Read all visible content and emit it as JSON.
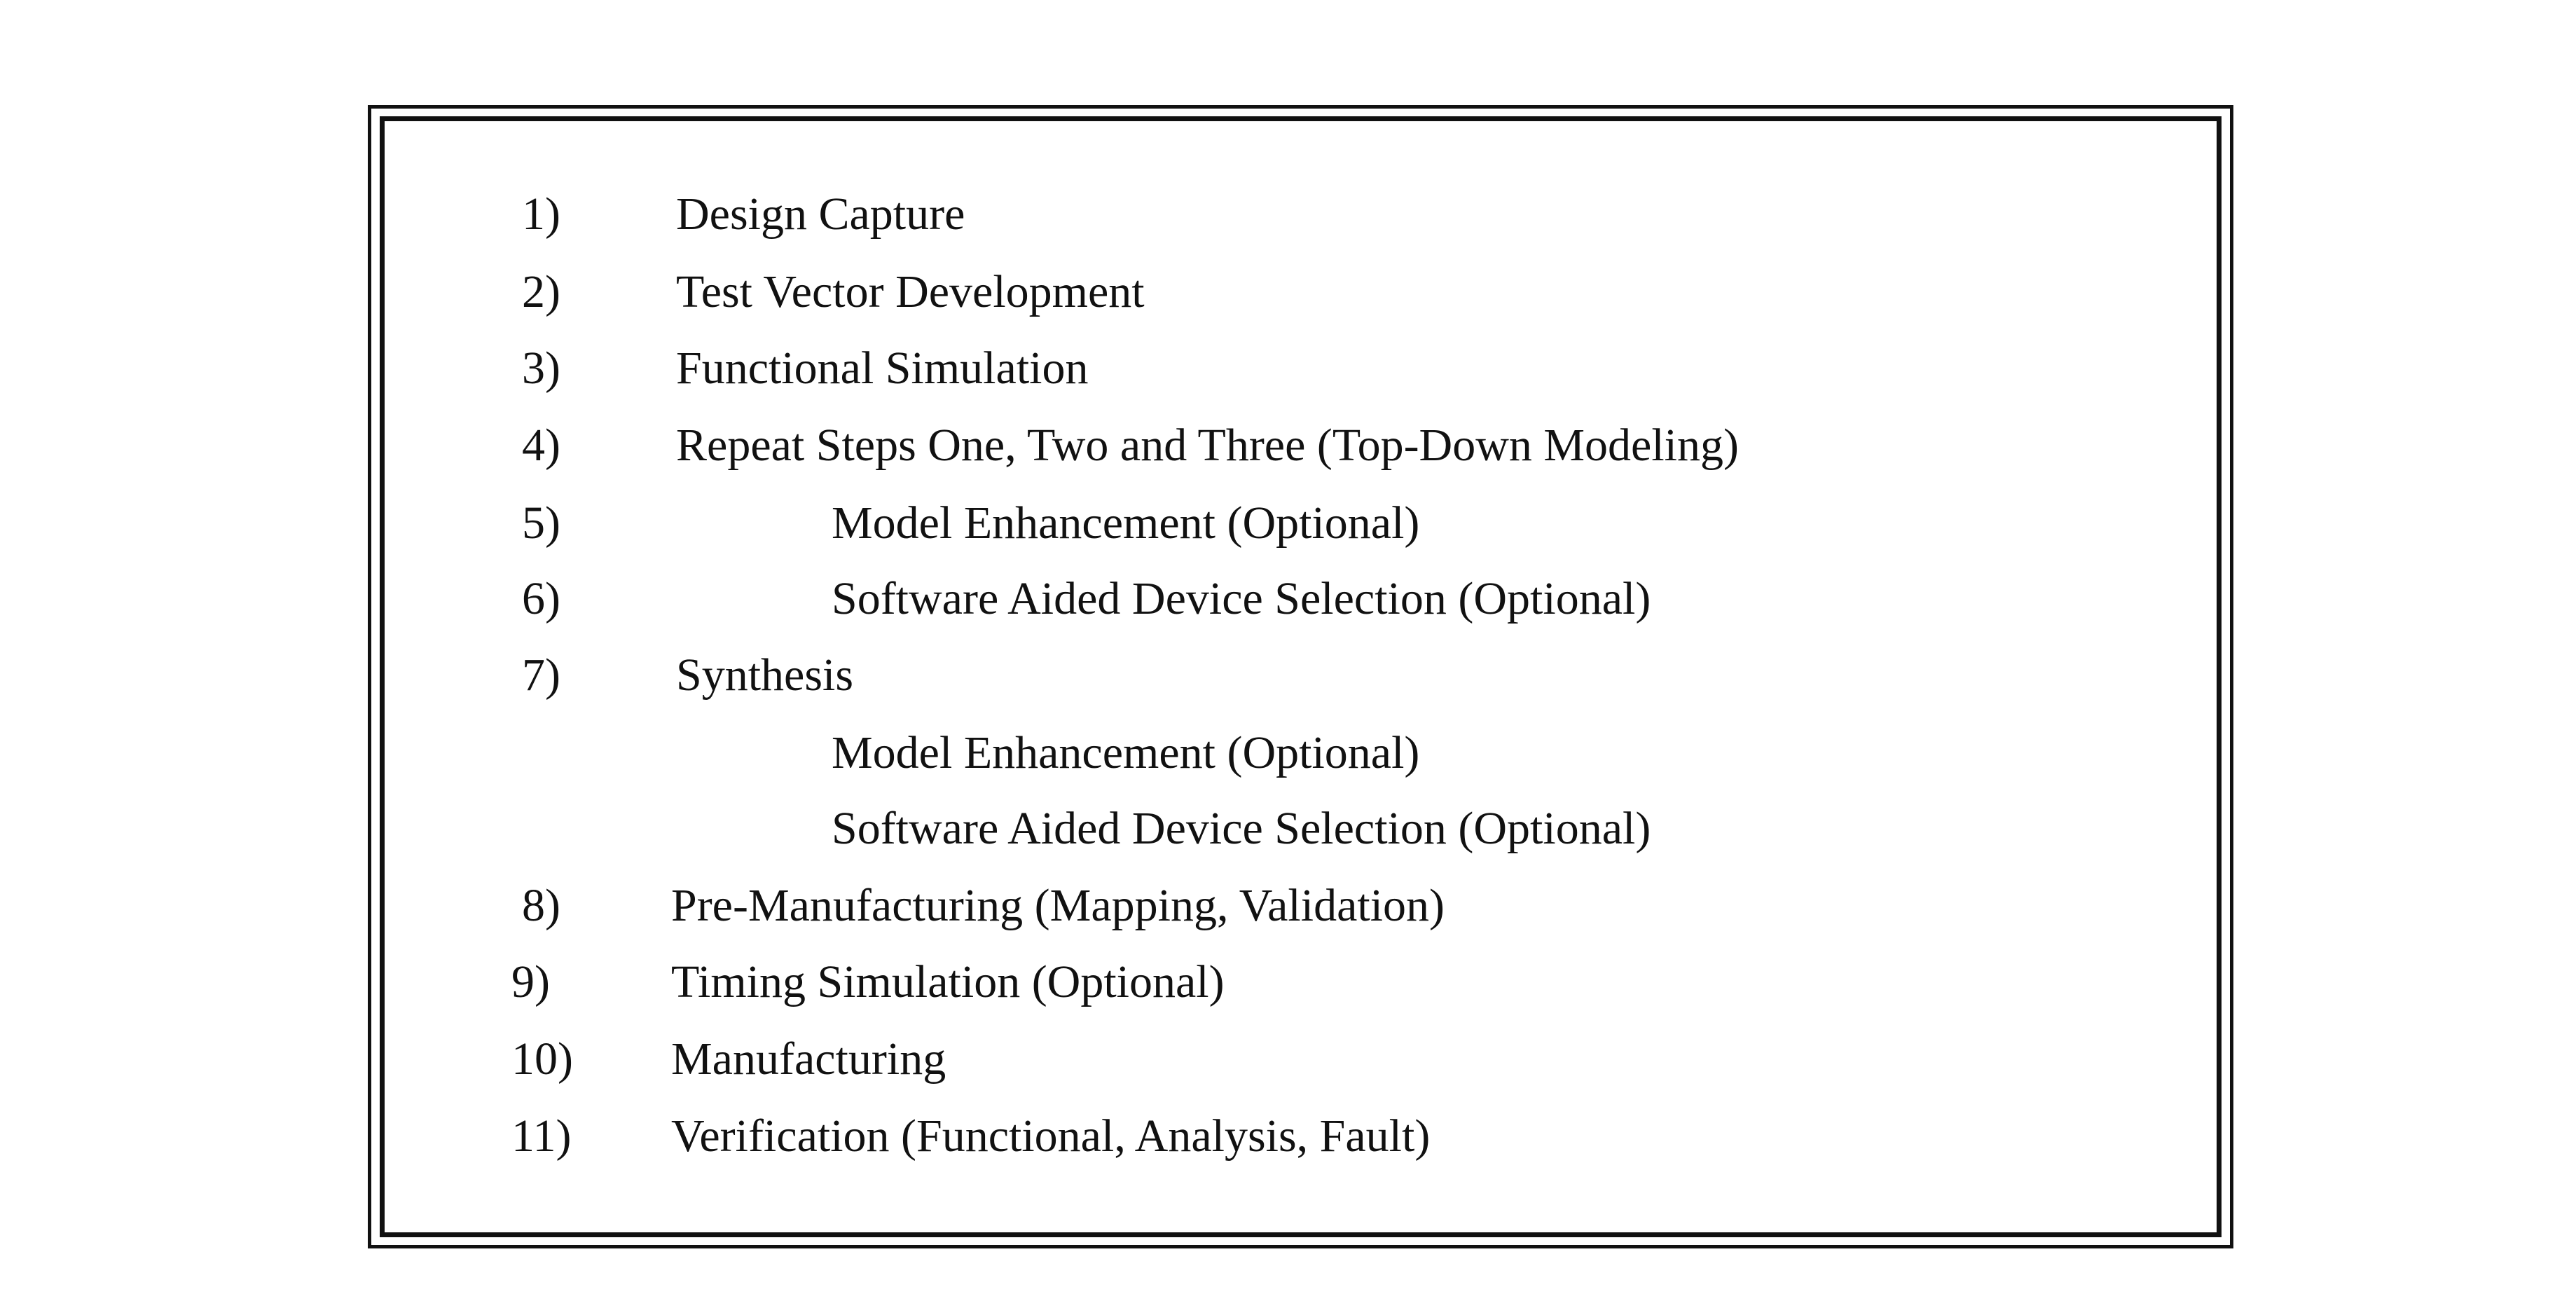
{
  "steps": [
    {
      "number": "1)",
      "label": "Design Capture"
    },
    {
      "number": "2)",
      "label": "Test Vector Development"
    },
    {
      "number": "3)",
      "label": "Functional Simulation"
    },
    {
      "number": "4)",
      "label": "Repeat Steps One, Two and Three (Top-Down Modeling)"
    },
    {
      "number": "5)",
      "label": "Model Enhancement (Optional)"
    },
    {
      "number": "6)",
      "label": "Software Aided Device Selection (Optional)"
    },
    {
      "number": "7)",
      "label": "Synthesis"
    },
    {
      "number": "",
      "label": "Model Enhancement (Optional)"
    },
    {
      "number": "",
      "label": "Software Aided Device Selection (Optional)"
    },
    {
      "number": "8)",
      "label": "Pre-Manufacturing (Mapping, Validation)"
    },
    {
      "number": "9)",
      "label": "Timing Simulation (Optional)"
    },
    {
      "number": "10)",
      "label": "Manufacturing"
    },
    {
      "number": "11)",
      "label": "Verification (Functional, Analysis, Fault)"
    }
  ]
}
